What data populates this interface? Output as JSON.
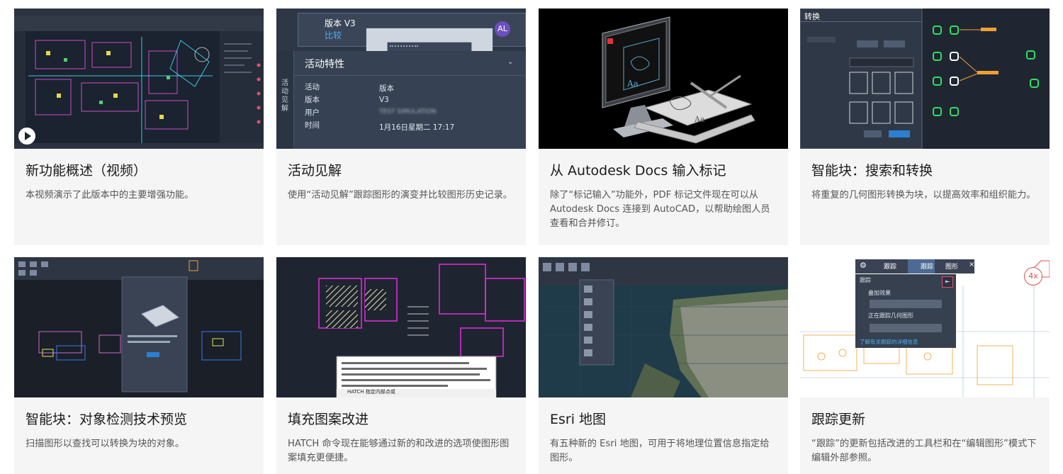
{
  "cards": [
    {
      "title": "新功能概述（视频）",
      "desc": "本视频演示了此版本中的主要增强功能。"
    },
    {
      "title": "活动见解",
      "desc": "使用“活动见解”跟踪图形的演变并比较图形历史记录。",
      "thumb": {
        "version_title": "版本 V3",
        "version_sub": "比较",
        "avatar": "AL",
        "panel_title": "活动特性",
        "side_label": "活动见解",
        "rows": [
          {
            "label": "活动",
            "value": "版本"
          },
          {
            "label": "版本",
            "value": "V3"
          },
          {
            "label": "用户",
            "value": "TEST SIMULATION"
          },
          {
            "label": "时间",
            "value": "1月16日星期二 17:17"
          }
        ]
      }
    },
    {
      "title": "从 Autodesk Docs 输入标记",
      "desc": "除了“标记输入”功能外，PDF 标记文件现在可以从 Autodesk Docs 连接到 AutoCAD，以帮助绘图人员查看和合并修订。"
    },
    {
      "title": "智能块：搜索和转换",
      "desc": "将重复的几何图形转换为块，以提高效率和组织能力。",
      "thumb": {
        "dialog_title": "转换"
      }
    },
    {
      "title": "智能块：对象检测技术预览",
      "desc": "扫描图形以查找可以转换为块的对象。"
    },
    {
      "title": "填充图案改进",
      "desc": "HATCH 命令现在能够通过新的和改进的选项使图形图案填充更便捷。",
      "thumb": {
        "cmd_line": "HATCH 指定内部点或"
      }
    },
    {
      "title": "Esri 地图",
      "desc": "有五种新的 Esri 地图，可用于将地理位置信息指定给图形。"
    },
    {
      "title": "跟踪更新",
      "desc": "“跟踪”的更新包括改进的工具栏和在“编辑图形”模式下编辑外部参照。",
      "thumb": {
        "tab1": "跟踪",
        "tab2": "图形",
        "panel_label": "跟踪",
        "opt1": "叠加效果",
        "opt2": "正在跟踪几何图形",
        "link": "了解有关跟踪的详细信息",
        "zoom": "4x"
      }
    }
  ]
}
